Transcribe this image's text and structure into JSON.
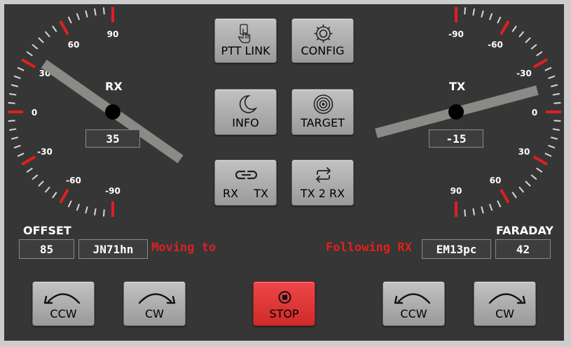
{
  "rx": {
    "label": "RX",
    "value": "35",
    "needle_deg": 35,
    "ticks": [
      {
        "t": "90",
        "a": 90
      },
      {
        "t": "60",
        "a": 60
      },
      {
        "t": "30",
        "a": 30
      },
      {
        "t": "0",
        "a": 0
      },
      {
        "t": "-30",
        "a": -30
      },
      {
        "t": "-60",
        "a": -60
      },
      {
        "t": "-90",
        "a": -90
      }
    ]
  },
  "tx": {
    "label": "TX",
    "value": "-15",
    "needle_deg": -15,
    "ticks": [
      {
        "t": "-90",
        "a": -90
      },
      {
        "t": "-60",
        "a": -60
      },
      {
        "t": "-30",
        "a": -30
      },
      {
        "t": "0",
        "a": 0
      },
      {
        "t": "30",
        "a": 30
      },
      {
        "t": "60",
        "a": 60
      },
      {
        "t": "90",
        "a": 90
      }
    ]
  },
  "buttons": {
    "ptt_link": "PTT LINK",
    "config": "CONFIG",
    "info": "INFO",
    "target": "TARGET",
    "link_rx": "RX",
    "link_tx": "TX",
    "tx2rx": "TX 2 RX",
    "ccw": "CCW",
    "cw": "CW",
    "stop": "STOP"
  },
  "offset": {
    "label": "OFFSET",
    "value": "85",
    "locator": "JN71hn",
    "status": "Moving to"
  },
  "faraday": {
    "label": "FARADAY",
    "value": "42",
    "locator": "EM13pc",
    "status": "Following RX"
  },
  "colors": {
    "accent_red": "#e01f1f",
    "panel": "#363636",
    "needle": "#8a8a86"
  },
  "icons": [
    "touch-hand-icon",
    "gear-icon",
    "moon-icon",
    "target-icon",
    "link-icon",
    "swap-arrows-icon",
    "ccw-arrow-icon",
    "cw-arrow-icon",
    "stop-circle-icon"
  ]
}
